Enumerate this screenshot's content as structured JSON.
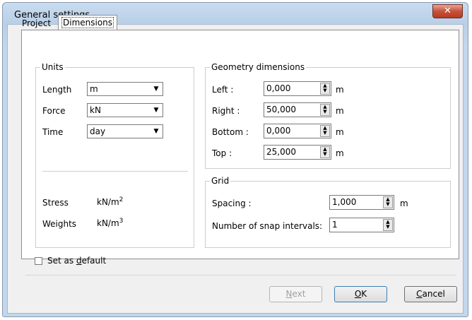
{
  "window": {
    "title": "General settings",
    "close_glyph": "✕"
  },
  "tabs": {
    "project": "Project",
    "dimensions": "Dimensions"
  },
  "units": {
    "legend": "Units",
    "length_label": "Length",
    "length_value": "m",
    "force_label": "Force",
    "force_value": "kN",
    "time_label": "Time",
    "time_value": "day",
    "stress_label": "Stress",
    "stress_unit": "kN/m",
    "stress_exp": "2",
    "weights_label": "Weights",
    "weights_unit": "kN/m",
    "weights_exp": "3"
  },
  "geometry": {
    "legend": "Geometry dimensions",
    "left_label": "Left :",
    "left_value": "0,000",
    "right_label": "Right :",
    "right_value": "50,000",
    "bottom_label": "Bottom :",
    "bottom_value": "0,000",
    "top_label": "Top :",
    "top_value": "25,000",
    "unit": "m"
  },
  "grid": {
    "legend": "Grid",
    "spacing_label": "Spacing :",
    "spacing_value": "1,000",
    "spacing_unit": "m",
    "snap_label": "Number of snap intervals:",
    "snap_value": "1"
  },
  "default_checkbox": {
    "label_pre": "Set as ",
    "label_accel": "d",
    "label_post": "efault",
    "checked": false
  },
  "buttons": {
    "next_accel": "N",
    "next_rest": "ext",
    "ok_accel": "O",
    "ok_rest": "K",
    "cancel_accel": "C",
    "cancel_rest": "ancel"
  },
  "glyphs": {
    "dropdown": "▼",
    "up": "▲",
    "down": "▼"
  }
}
